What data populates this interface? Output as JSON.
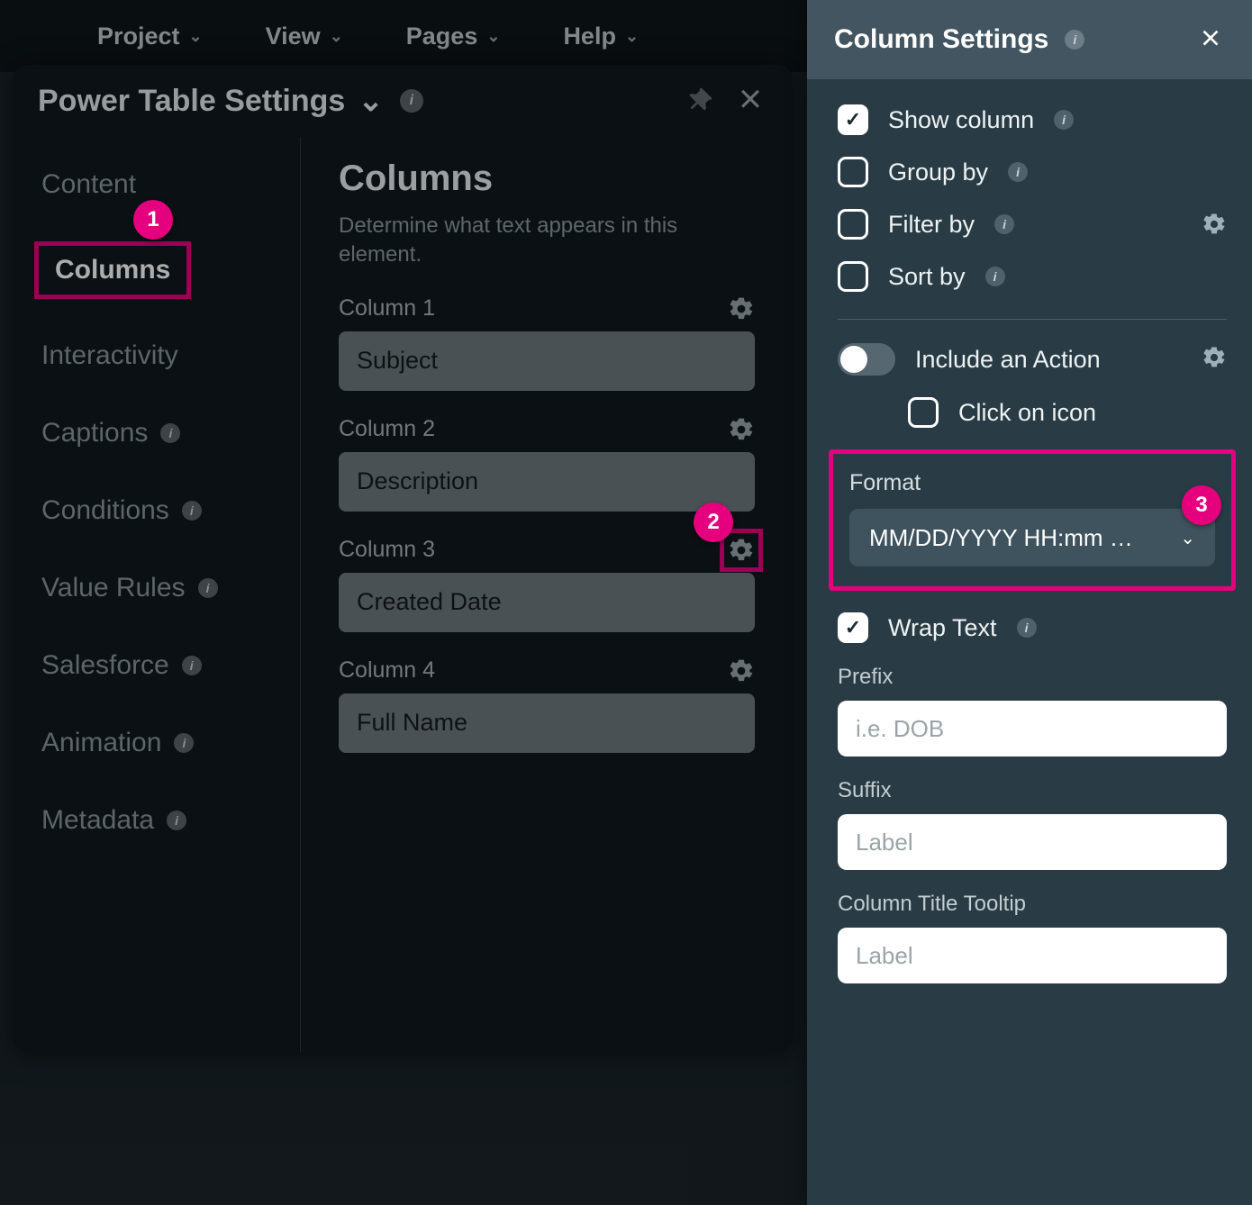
{
  "menubar": {
    "items": [
      "Project",
      "View",
      "Pages",
      "Help"
    ]
  },
  "leftPanel": {
    "title": "Power Table Settings",
    "sideTabs": [
      {
        "label": "Content",
        "info": false
      },
      {
        "label": "Columns",
        "info": false,
        "active": true
      },
      {
        "label": "Interactivity",
        "info": false
      },
      {
        "label": "Captions",
        "info": true
      },
      {
        "label": "Conditions",
        "info": true
      },
      {
        "label": "Value Rules",
        "info": true
      },
      {
        "label": "Salesforce",
        "info": true
      },
      {
        "label": "Animation",
        "info": true
      },
      {
        "label": "Metadata",
        "info": true
      }
    ],
    "columnsTitle": "Columns",
    "columnsDesc": "Determine what text appears in this element.",
    "columns": [
      {
        "label": "Column 1",
        "value": "Subject"
      },
      {
        "label": "Column 2",
        "value": "Description"
      },
      {
        "label": "Column 3",
        "value": "Created Date"
      },
      {
        "label": "Column 4",
        "value": "Full Name"
      }
    ]
  },
  "rightPanel": {
    "title": "Column Settings",
    "checks": [
      {
        "label": "Show column",
        "checked": true,
        "info": true
      },
      {
        "label": "Group by",
        "checked": false,
        "info": true
      },
      {
        "label": "Filter by",
        "checked": false,
        "info": true,
        "gear": true
      },
      {
        "label": "Sort by",
        "checked": false,
        "info": true
      }
    ],
    "includeAction": {
      "label": "Include an Action",
      "gear": true
    },
    "clickIcon": {
      "label": "Click on icon"
    },
    "format": {
      "label": "Format",
      "value": "MM/DD/YYYY HH:mm …"
    },
    "wrap": {
      "label": "Wrap Text",
      "checked": true,
      "info": true
    },
    "prefix": {
      "label": "Prefix",
      "placeholder": "i.e. DOB"
    },
    "suffix": {
      "label": "Suffix",
      "placeholder": "Label"
    },
    "tooltip": {
      "label": "Column Title Tooltip",
      "placeholder": "Label"
    }
  },
  "callouts": {
    "c1": "1",
    "c2": "2",
    "c3": "3"
  },
  "glyphs": {
    "chevDown": "⌄"
  }
}
